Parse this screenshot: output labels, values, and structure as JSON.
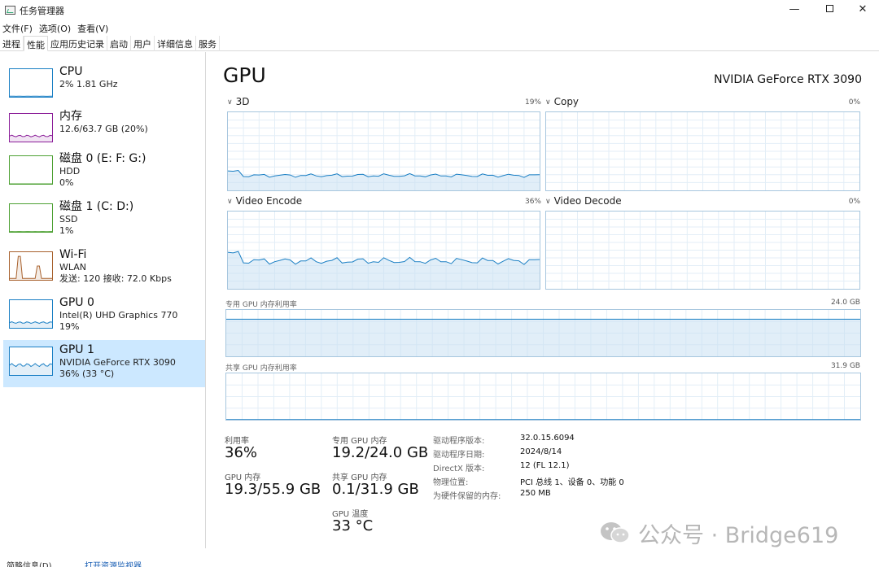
{
  "window": {
    "title": "任务管理器",
    "min_label": "—",
    "close_label": "✕"
  },
  "menu": [
    "文件(F)",
    "选项(O)",
    "查看(V)"
  ],
  "tabs": [
    "进程",
    "性能",
    "应用历史记录",
    "启动",
    "用户",
    "详细信息",
    "服务"
  ],
  "active_tab": "性能",
  "sidebar": [
    {
      "title": "CPU",
      "line1": "2%  1.81 GHz",
      "line2": "",
      "line3": "",
      "color": "#1a7fc4",
      "level": 0.02
    },
    {
      "title": "内存",
      "line1": "12.6/63.7 GB (20%)",
      "line2": "",
      "line3": "",
      "color": "#8b1e99",
      "level": 0.2
    },
    {
      "title": "磁盘 0 (E: F: G:)",
      "line1": "HDD",
      "line2": "0%",
      "line3": "",
      "color": "#4da133",
      "level": 0.0
    },
    {
      "title": "磁盘 1 (C: D:)",
      "line1": "SSD",
      "line2": "1%",
      "line3": "",
      "color": "#4da133",
      "level": 0.01
    },
    {
      "title": "Wi-Fi",
      "line1": "WLAN",
      "line2": "发送: 120  接收: 72.0 Kbps",
      "line3": "",
      "color": "#a8612d",
      "level": 0.6
    },
    {
      "title": "GPU 0",
      "line1": "Intel(R) UHD Graphics 770",
      "line2": "19%",
      "line3": "",
      "color": "#1a7fc4",
      "level": 0.19
    },
    {
      "title": "GPU 1",
      "line1": "NVIDIA GeForce RTX 3090",
      "line2": "36% (33 °C)",
      "line3": "",
      "color": "#1a7fc4",
      "level": 0.36
    }
  ],
  "main": {
    "title": "GPU",
    "device": "NVIDIA GeForce RTX 3090",
    "engines": [
      {
        "label": "3D",
        "pct": "19%",
        "level": 0.19
      },
      {
        "label": "Copy",
        "pct": "0%",
        "level": 0.0
      },
      {
        "label": "Video Encode",
        "pct": "36%",
        "level": 0.36
      },
      {
        "label": "Video Decode",
        "pct": "0%",
        "level": 0.0
      }
    ],
    "dedicated_label": "专用 GPU 内存利用率",
    "dedicated_max": "24.0 GB",
    "dedicated_level": 0.8,
    "shared_label": "共享 GPU 内存利用率",
    "shared_max": "31.9 GB",
    "shared_level": 0.003
  },
  "stats": {
    "util_label": "利用率",
    "util_value": "36%",
    "gpu_mem_label": "GPU 内存",
    "gpu_mem_value": "19.3/55.9 GB",
    "ded_label": "专用 GPU 内存",
    "ded_value": "19.2/24.0 GB",
    "shared_label": "共享 GPU 内存",
    "shared_value": "0.1/31.9 GB",
    "temp_label": "GPU 温度",
    "temp_value": "33 °C"
  },
  "info": [
    {
      "key": "驱动程序版本:",
      "value": "32.0.15.6094"
    },
    {
      "key": "驱动程序日期:",
      "value": "2024/8/14"
    },
    {
      "key": "DirectX 版本:",
      "value": "12 (FL 12.1)"
    },
    {
      "key": "物理位置:",
      "value": "PCI 总线 1、设备 0、功能 0"
    },
    {
      "key": "为硬件保留的内存:",
      "value": "250 MB"
    }
  ],
  "watermark": "公众号 · Bridge619",
  "footer": {
    "details": "简略信息(D)",
    "monitor": "打开资源监视器"
  }
}
